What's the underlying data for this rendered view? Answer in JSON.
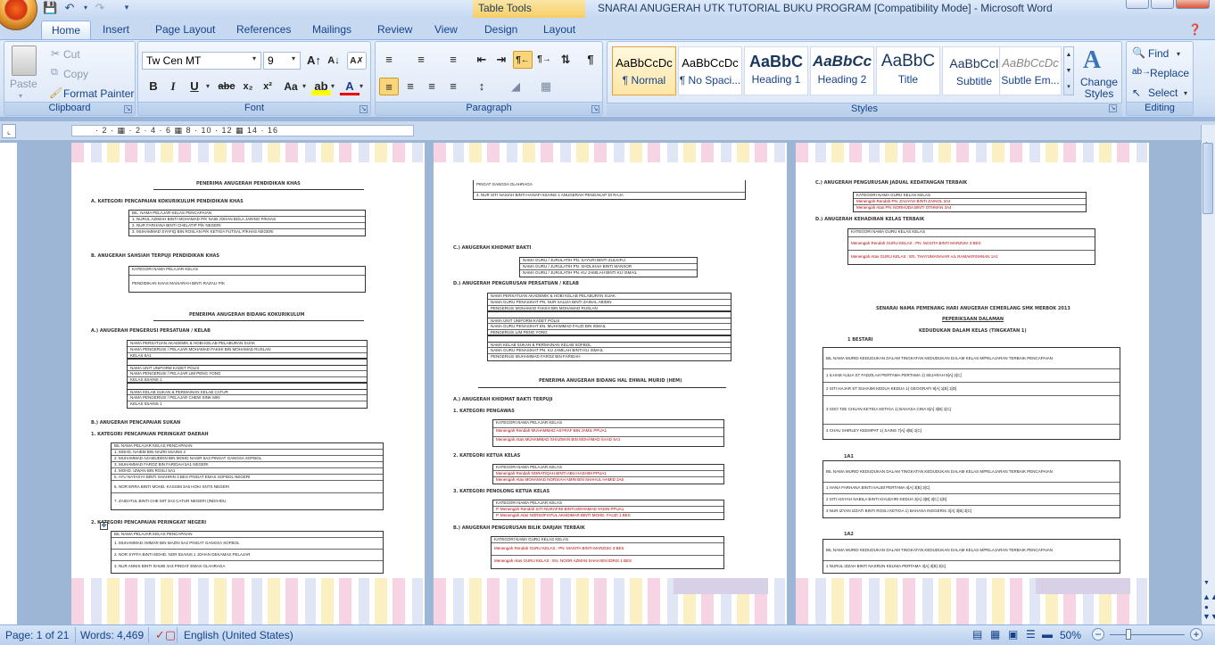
{
  "window": {
    "title": "SNARAI ANUGERAH UTK TUTORIAL BUKU PROGRAM [Compatibility Mode] - Microsoft Word",
    "contextual_tab": "Table Tools"
  },
  "tabs": [
    "Home",
    "Insert",
    "Page Layout",
    "References",
    "Mailings",
    "Review",
    "View",
    "Design",
    "Layout"
  ],
  "ribbon": {
    "clipboard": {
      "label": "Clipboard",
      "paste": "Paste",
      "cut": "Cut",
      "copy": "Copy",
      "format_painter": "Format Painter"
    },
    "font": {
      "label": "Font",
      "font_name": "Tw Cen MT",
      "font_size": "9"
    },
    "paragraph": {
      "label": "Paragraph"
    },
    "styles": {
      "label": "Styles",
      "items": [
        {
          "preview": "AaBbCcDc",
          "name": "¶ Normal"
        },
        {
          "preview": "AaBbCcDc",
          "name": "¶ No Spaci..."
        },
        {
          "preview": "AaBbC",
          "name": "Heading 1"
        },
        {
          "preview": "AaBbCc",
          "name": "Heading 2"
        },
        {
          "preview": "AaBbC",
          "name": "Title"
        },
        {
          "preview": "AaBbCcI",
          "name": "Subtitle"
        },
        {
          "preview": "AaBbCcDc",
          "name": "Subtle Em..."
        }
      ],
      "change_styles": "Change Styles"
    },
    "editing": {
      "label": "Editing",
      "find": "Find",
      "replace": "Replace",
      "select": "Select"
    }
  },
  "ruler": {
    "marks": "· 2 · ▦ · 2 · 4 · 6 ▦ 8 · 10 · 12 ▦ 14 · 16"
  },
  "pages": {
    "p1": {
      "h1": "PENERIMA ANUGERAH PENDIDIKAN KHAS",
      "a": "A.  KATEGORI PENCAPAIAN KOKURIKULUM PENDIDIKAN KHAS",
      "a_rows": [
        "BIL.   NAMA PELAJAR                      KELAS        PENCAPAIAN",
        "1.   NURUL AZIMAH BINTI MOHAMAD      P/K     NAIB JOHAN BOLA JARING P/KHAS",
        "2.   NUR FARHANA BINTI CHELATIP         P/K          NEGERI",
        "3.   MUHAMMAD SYAFIQ BIN ROSLAN      P/K     KETIGA FUTSAL P/KHAS NEGERI"
      ],
      "b": "B.  ANUGERAH SAHSIAH TERPUJI PENDIDIKAN KHAS",
      "b_rows": [
        "KATEGORI                    NAMA PELAJAR                KELAS",
        "PENDIDIKAN KHAS          MAISARAH BINTI RAZALI             P/K"
      ],
      "h2": "PENERIMA ANUGERAH BIDANG KOKURIKULUM",
      "c": "A.)  ANUGERAH PENGERUSI PERSATUAN / KELAB",
      "c_rows": [
        "NAMA PERSATUAN AKADEMIK & HOBI     KELAB PELABURAN SIJAK",
        "NAMA PENGERUSI / PELAJAR          MOHAMAD FAKIHI BIN MOHAMAD RUSLAN",
        "KELAS                               5A1",
        "NAMA UNIT UNIFORM                   KADET POLIS",
        "NAMA PENGERUSI / PELAJAR          LIM PENG YONG",
        "KELAS                               5SAINS 1",
        "NAMA KELAB SUKAN & PERMAINAN       KELAB CATUR",
        "NAMA PENGERUSI / PELAJAR          CHEW SINK MIN",
        "KELAS                               5SAINS 1"
      ],
      "d": "B.)  ANUGERAH PENCAPAIAN SUKAN",
      "d1": "1.  KATEGORI PENCAPAIAN PERINGKAT DAERAH",
      "d_rows": [
        "BIL    NAMA PELAJAR                    KELAS      PENCAPAIAN",
        "1.  MOHD. NAIEM BIN NAZRI               5SAINS 2",
        "2.  MUHAMMAD AZAMUDDIN BIN MOHD NASIR   5A3    PINGAT GANGSA SOFBOL",
        "3.  MUHAMMAD FAROZ BIN FARIDAH          5A1    NEGERI",
        "4.  MOHD. IZWAN BIN ROSLI               5A1",
        "5.  AYU NATASYA BINTI SHAHRIN           3 BES  PINGAT EMAS SOFBOL NEGERI",
        "6.  NOR ERRA BINTI MOHD. KASSIM         3A5    HOKI SNTS NEGERI",
        "7.  ZAIDATUL BINTI CHE MIT              3A3    CATUR NEGERI (INDIVIDU"
      ],
      "e": "2.  KATEGORI PENCAPAIAN PERINGKAT NEGERI",
      "e_rows": [
        "BIL    NAMA PELAJAR                    KELAS      PENCAPAIAN",
        "1.  MUHAMMAD AMMAR BIN MAZNI            5A2    PINGAT GANGSA SOFBOL",
        "2.  NOR SYFFA BINTI MOHD. NOR           5SAINS 1  JOHAN DEKAMAS PELAJAR",
        "3.  NUR ANNIS BINTI SHUIB              4A3    PINGAT EMAS OLAHRAGA"
      ]
    },
    "p2": {
      "top_rows": [
        "                                               PINGAT GANGSA OLAHRAGA",
        "4.   NUR SITI NASIAH BINTI HANAFI        5SAINS 1   ANUGERAH PENGAKAP DI RAJA"
      ],
      "c": "C.)  ANUGERAH KHIDMAT BAKTI",
      "c_rows": [
        "NAMA GURU / JURULATIH     PN. SAYURI BINTI ZULKIFLI",
        "NAMA GURU / JURULATIH     PN. SHOLIHAH BINTI MANSOR",
        "NAMA GURU / JURULATIH     PN. KU JAMILAH BINTI KU ISMAIL"
      ],
      "d": "D.)  ANUGERAH PENGURUSAN PERSATUAN / KELAB",
      "d_rows": [
        "NAMA PERSATUAN AKADEMIK & HOBI     KELAB PELABURAN SIJAK",
        "NAMA GURU PENASIHAT               PN. NUR SALIZA BINTI ZAINAL ABIDIN",
        "PENGERUSI                         MOHAMAD FAKIHI BIN MOHAMAD RUSLAN",
        "NAMA UNIT UNIFORM                 KADET POLIS",
        "NAMA GURU PENASIHAT               EN. MUHAMMAD FAUZI BIN ISMAIL",
        "PENGERUSI                         LIM PENG YONG",
        "NAMA KELAB SUKAN & PERMAINAN      KELAB SOFBOL",
        "NAMA GURU PENASIHAT               PN. KU JAMILAH BINTI KU ISMAIL",
        "PENGERUSI                         MUHAMMAD FAROZ BIN FARIDAH"
      ],
      "h": "PENERIMA ANUGERAH BIDANG HAL EHWAL MURID (HEM)",
      "a": "A.)  ANUGERAH KHIDMAT BAKTI TERPUJI",
      "a1": "1.  KATEGORI PENGAWAS",
      "a1_rows": [
        "KATEGORI                 NAMA PELAJAR                       KELAS",
        "Menengah Rendah     MUHAMMAD ASYRAF BIN JAMIL           PPUA1",
        "Menengah Atas       MUHAMMAD SHAZWAN BIN MOHAMAD SAAD    5A1"
      ],
      "a2": "2.  KATEGORI KETUA KELAS",
      "a2_rows": [
        "KATEGORI                 NAMA PELAJAR                       KELAS",
        "Menengah Rendah     NORATIQAH BINTI ABU HASHIM           PPUA1",
        "Menengah Atas       MOHAMAD NORSIAH AMIN BIN SHAHUL HAMID  3A5"
      ],
      "a3": "3.  KATEGORI PENOLONG KETUA KELAS",
      "a3_rows": [
        "KATEGORI                 NAMA PELAJAR                       KELAS",
        "P. Menengah Rendah   SITI NURAFINI BINTI MOHAMAD YADIN    PPUA1",
        "P. Menengah Atas     NORSOFIATUL AKHDIMAR BINTI MOHD. FAUZI  1 BES"
      ],
      "b": "B.)  ANUGERAH PENGURUSAN BILIK DARJAH TERBAIK",
      "b_rows": [
        "KATEGORI                 NAMA GURU KELAS                    KELAS",
        "Menengah Rendah   GURU KELAS : PN. MASITA BINTI MARZUKI     3 BES",
        "Menengah Atas     GURU KELAS : EN. NOOR AZMAN SHAH BIN IDRIS  1 BES"
      ]
    },
    "p3": {
      "c": "C.)  ANUGERAH PENGURUSAN JADUAL KEDATANGAN TERBAIK",
      "c_rows": [
        "KATEGORI                NAMA GURU KELAS               KELAS",
        "Menengah Rendah    PN. ZAUYAH BINTI ZAINOL          3A2",
        "Menengah Atas      PN. NORHUDA BINTI OTHMAN         3A4"
      ],
      "d": "D.)  ANUGERAH KEHADIRAN KELAS TERBAIK",
      "d_rows": [
        "KATEGORI                NAMA GURU KELAS               KELAS",
        "Menengah Rendah   GURU KELAS : PN. MASITA BINTI MARZUKI   3 BES",
        "Menengah Atas     GURU KELAS : EN. THAYUMANAVAR A/L RAMAKRISHNAN  1A1"
      ],
      "h1": "SENARAI NAMA PEMENANG HARI ANUGERAH CEMERLANG SMK MERBOK 2013",
      "h2": "PEPERIKSAAN DALAMAN",
      "h3": "KEDUDUKAN DALAM KELAS (TINGKATAN 1)",
      "k1": "1 BESTARI",
      "k1_rows": [
        "BIL   NAMA MURID        KEDUDUKAN DALAM TINGKATAN   KEDUDUKAN DALAM KELAS   M/PELAJARAN TERBAIK   PENCAPAIAN",
        "1   ILHAM AULIA ST FADZILAH     PERTAMA     PERTAMA    1) SEJARAH          9[A] 2[C]",
        "2   SITI HAJAR ST SUHAIMI       KEDUA       KEDUA      1) GEOGRAFI         9[A] 1[B] 1[D]",
        "3   SOO TZE CHUAN               KETIGA      KETIGA     1) BAHASA CINA       8[A] 3[B] 1[C]",
        "4   CHAU SHIRLEY                KEEMPAT                1) SAINS            7[A] 4[B] 1[C]"
      ],
      "k2": "1A1",
      "k2_rows": [
        "BIL   NAMA MURID        KEDUDUKAN DALAM TINGKATAN   KEDUDUKAN DALAM KELAS   M/PELAJARAN TERBAIK   PENCAPAIAN",
        "1   HANA FARHANA BINTI HALIM               PERTAMA                     4[A] 3[B] 3[C]",
        "2   SITI AISYAH NABILA BINTI KHUZAIRI      KEDUA                       3[A] 3[B] 3[C] 1[D]",
        "3   NUR IZYAN IZZATI BINTI ROSLI           KETIGA     1) BAHASA INGGERIS  3[A] 3[B] 3[C]"
      ],
      "k3": "1A2",
      "k3_rows": [
        "BIL   NAMA MURID        KEDUDUKAN DALAM TINGKATAN   KEDUDUKAN DALAM KELAS   M/PELAJARAN TERBAIK   PENCAPAIAN",
        "1   NURUL IZZAH BINTI NASRUN      KELIMA     PERTAMA               3[A] 3[B] 3[C]"
      ]
    }
  },
  "status": {
    "page": "Page: 1 of 21",
    "words": "Words: 4,469",
    "language": "English (United States)",
    "zoom": "50%"
  },
  "colors": {
    "accent": "#15428b",
    "ribbon": "#dbe7f7",
    "tab_tools": "#f6cf66"
  }
}
